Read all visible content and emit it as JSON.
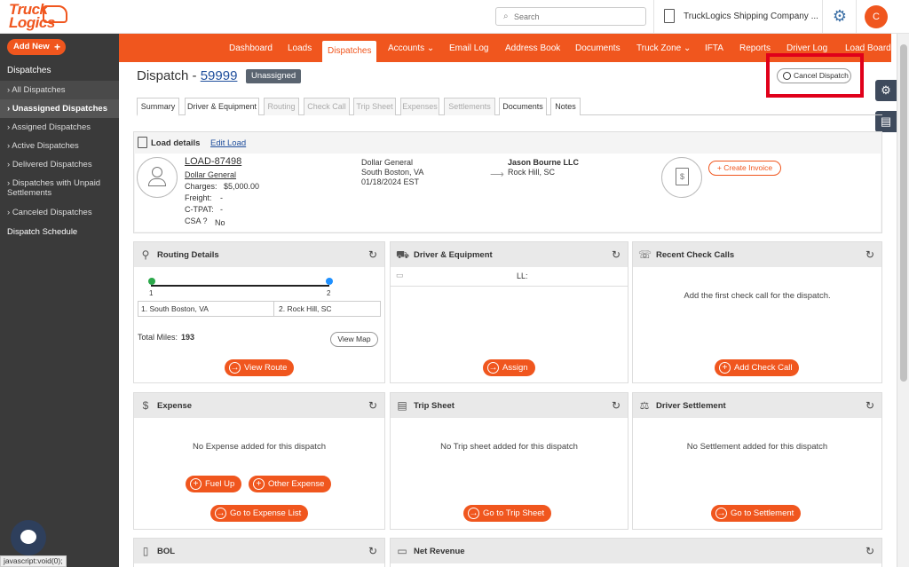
{
  "header": {
    "logo_line1": "Truck",
    "logo_line2": "Logics",
    "search_placeholder": "Search",
    "company_name": "TruckLogics Shipping Company ...",
    "avatar_initial": "C"
  },
  "sidebar": {
    "add_new": "Add New",
    "section": "Dispatches",
    "items": [
      {
        "label": "All Dispatches"
      },
      {
        "label": "Unassigned Dispatches"
      },
      {
        "label": "Assigned Dispatches"
      },
      {
        "label": "Active Dispatches"
      },
      {
        "label": "Delivered Dispatches"
      },
      {
        "label": "Dispatches with Unpaid Settlements"
      },
      {
        "label": "Canceled Dispatches"
      }
    ],
    "schedule": "Dispatch Schedule",
    "status_url": "javascript:void(0);"
  },
  "nav": {
    "items": [
      "Dashboard",
      "Loads",
      "Dispatches",
      "Accounts ⌄",
      "Email Log",
      "Address Book",
      "Documents",
      "Truck Zone ⌄",
      "IFTA",
      "Reports",
      "Driver Log",
      "Load Board"
    ]
  },
  "page": {
    "title_prefix": "Dispatch -",
    "dispatch_number": "59999",
    "status_badge": "Unassigned",
    "cancel_label": "Cancel Dispatch"
  },
  "tabs": [
    "Summary",
    "Driver & Equipment",
    "Routing",
    "Check Call",
    "Trip Sheet",
    "Expenses",
    "Settlements",
    "Documents",
    "Notes"
  ],
  "load_details": {
    "header": "Load details",
    "edit_label": "Edit Load",
    "load_number": "LOAD-87498",
    "customer": "Dollar General",
    "charges_label": "Charges:",
    "charges_value": "$5,000.00",
    "freight_label": "Freight:",
    "freight_value": "-",
    "ctpat_label": "C-TPAT:",
    "ctpat_value": "-",
    "csa_label": "CSA ?",
    "csa_value": "No",
    "pickup_name": "Dollar General",
    "pickup_city": "South Boston, VA",
    "pickup_date": "01/18/2024 EST",
    "delivery_name": "Jason Bourne LLC",
    "delivery_city": "Rock Hill, SC",
    "create_invoice": "Create Invoice"
  },
  "routing": {
    "title": "Routing Details",
    "stop1_num": "1",
    "stop2_num": "2",
    "stop1": "1. South Boston, VA",
    "stop2": "2. Rock Hill, SC",
    "total_miles_label": "Total Miles:",
    "total_miles": "193",
    "view_map": "View Map",
    "view_route": "View Route"
  },
  "driver_equipment": {
    "title": "Driver & Equipment",
    "ll": "LL:",
    "assign": "Assign"
  },
  "check_calls": {
    "title": "Recent Check Calls",
    "empty": "Add the first check call for the dispatch.",
    "add": "Add Check Call"
  },
  "expense": {
    "title": "Expense",
    "empty": "No Expense added for this dispatch",
    "fuel_up": "Fuel Up",
    "other": "Other Expense",
    "go_to": "Go to Expense List"
  },
  "trip_sheet": {
    "title": "Trip Sheet",
    "empty": "No Trip sheet added for this dispatch",
    "go_to": "Go to Trip Sheet"
  },
  "driver_settlement": {
    "title": "Driver Settlement",
    "empty": "No Settlement added for this dispatch",
    "go_to": "Go to Settlement"
  },
  "bol": {
    "title": "BOL"
  },
  "net_revenue": {
    "title": "Net Revenue"
  },
  "colors": {
    "accent": "#f0561e",
    "sidebar": "#3a3a3a",
    "link": "#1f4e9c",
    "highlight": "#e0001a"
  }
}
